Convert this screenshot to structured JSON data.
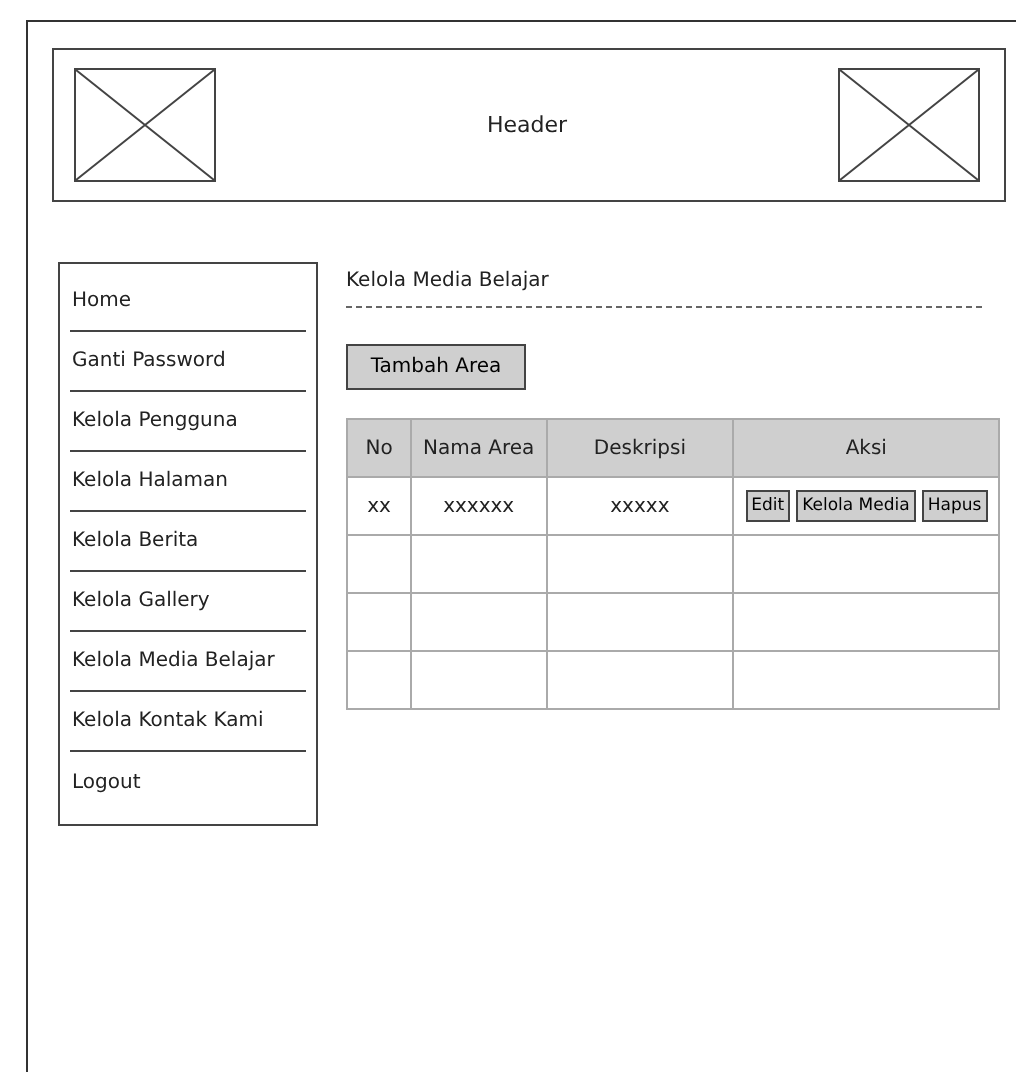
{
  "header": {
    "title": "Header"
  },
  "sidebar": {
    "items": [
      {
        "label": "Home"
      },
      {
        "label": "Ganti Password"
      },
      {
        "label": "Kelola Pengguna"
      },
      {
        "label": "Kelola Halaman"
      },
      {
        "label": "Kelola Berita"
      },
      {
        "label": "Kelola Gallery"
      },
      {
        "label": "Kelola Media Belajar"
      },
      {
        "label": "Kelola Kontak Kami"
      },
      {
        "label": "Logout"
      }
    ]
  },
  "content": {
    "title": "Kelola Media Belajar",
    "add_button": "Tambah Area"
  },
  "table": {
    "columns": [
      "No",
      "Nama Area",
      "Deskripsi",
      "Aksi"
    ],
    "rows": [
      {
        "no": "xx",
        "nama_area": "xxxxxx",
        "deskripsi": "xxxxx",
        "actions": [
          "Edit",
          "Kelola Media",
          "Hapus"
        ]
      },
      {},
      {},
      {}
    ]
  }
}
